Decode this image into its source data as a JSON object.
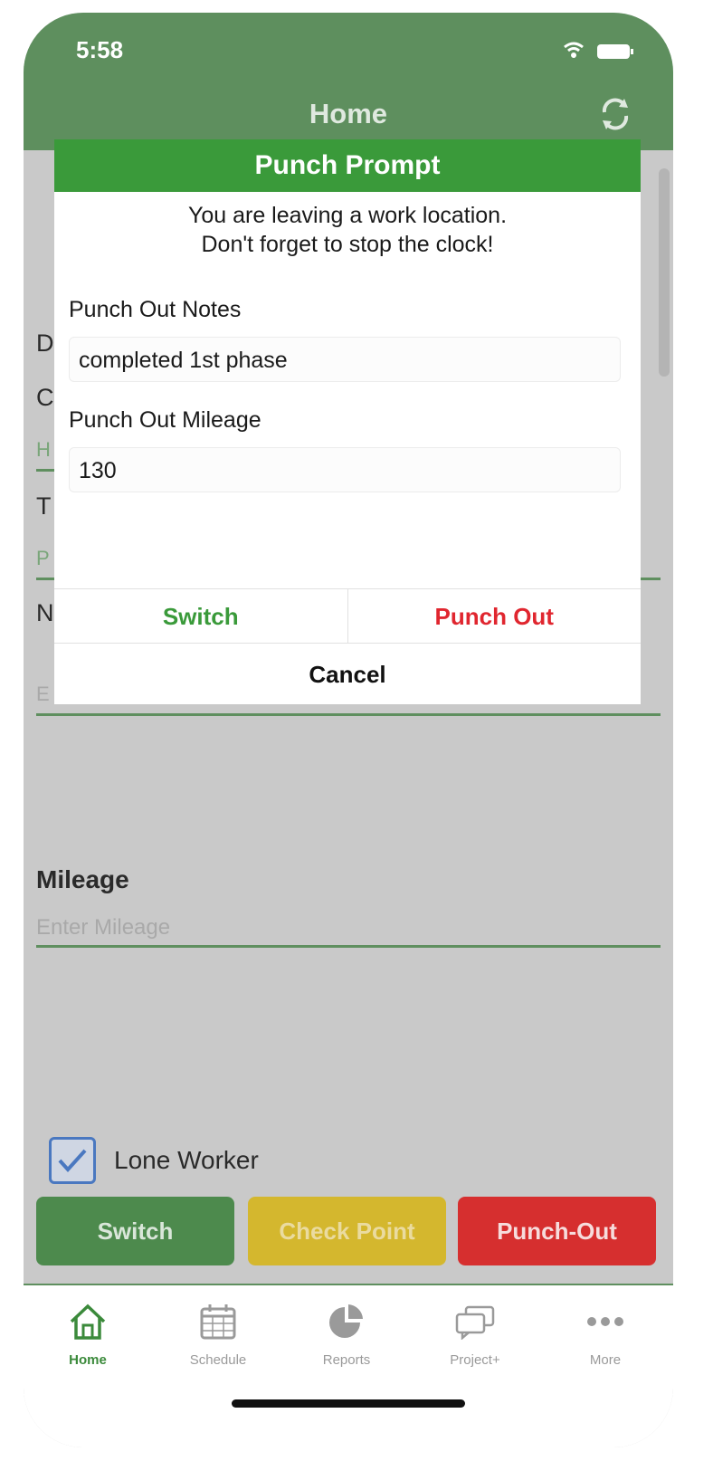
{
  "status_bar": {
    "time": "5:58"
  },
  "nav": {
    "title": "Home"
  },
  "background_form": {
    "partial_labels": [
      "D",
      "C",
      "T",
      "N"
    ],
    "partial_values": [
      "H",
      "P",
      "E"
    ],
    "mileage_label": "Mileage",
    "mileage_placeholder": "Enter Mileage",
    "lone_worker_label": "Lone Worker",
    "lone_worker_checked": true
  },
  "actions": {
    "switch_label": "Switch",
    "checkpoint_label": "Check Point",
    "punchout_label": "Punch-Out"
  },
  "modal": {
    "title": "Punch Prompt",
    "message_line1": "You are leaving a work location.",
    "message_line2": "Don't forget to stop the clock!",
    "notes_label": "Punch Out Notes",
    "notes_value": "completed 1st phase",
    "mileage_label": "Punch Out Mileage",
    "mileage_value": "130",
    "switch_label": "Switch",
    "punch_out_label": "Punch Out",
    "cancel_label": "Cancel"
  },
  "tabs": [
    {
      "label": "Home",
      "icon": "home-icon",
      "active": true
    },
    {
      "label": "Schedule",
      "icon": "calendar-icon",
      "active": false
    },
    {
      "label": "Reports",
      "icon": "pie-chart-icon",
      "active": false
    },
    {
      "label": "Project+",
      "icon": "chat-bubbles-icon",
      "active": false
    },
    {
      "label": "More",
      "icon": "more-dots-icon",
      "active": false
    }
  ],
  "colors": {
    "brand_green": "#3a9a3a",
    "danger_red": "#e0262f",
    "checkpoint_yellow": "#d4b72e"
  }
}
